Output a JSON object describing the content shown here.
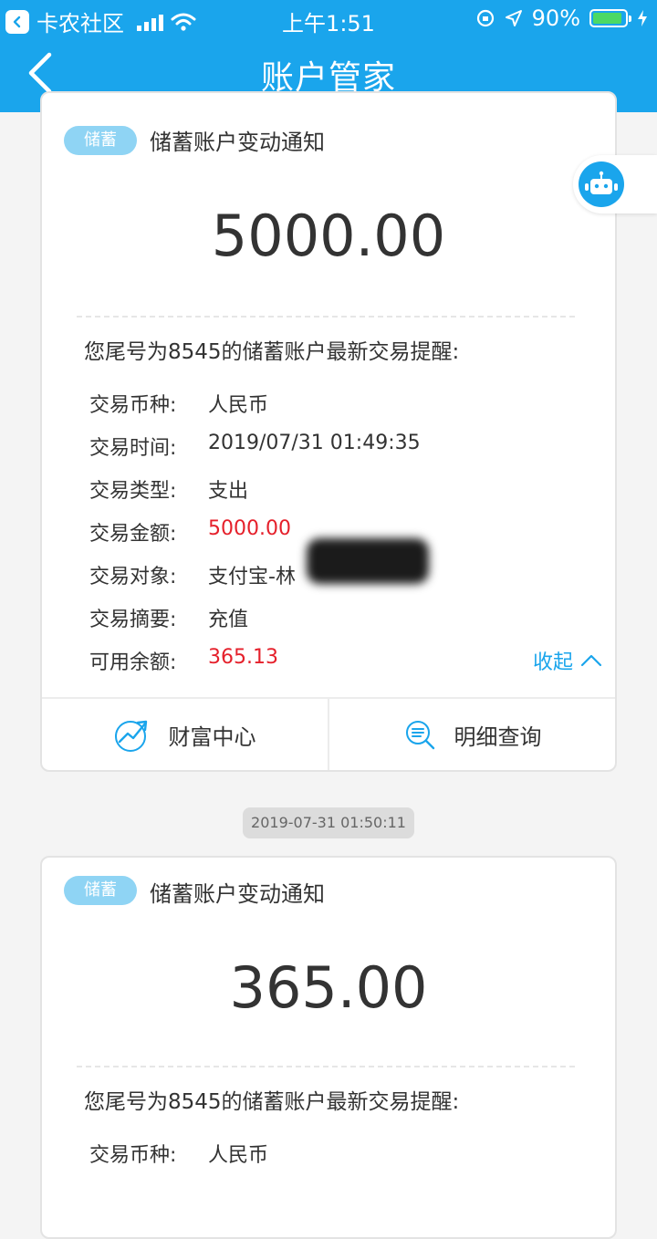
{
  "status_bar": {
    "carrier": "卡农社区",
    "time": "上午1:51",
    "battery": "90%",
    "battery_level": 0.9,
    "battery_color": "#4cd964"
  },
  "nav": {
    "title": "账户管家",
    "back_icon": "chevron-left-icon"
  },
  "colors": {
    "brand": "#1aa5ec",
    "amount_red": "#e5202b"
  },
  "assistant": {
    "icon": "robot-icon"
  },
  "card1": {
    "badge": "储蓄",
    "title": "储蓄账户变动通知",
    "amount": "5000.00",
    "notice": "您尾号为8545的储蓄账户最新交易提醒:",
    "rows": [
      {
        "label": "交易币种:",
        "value": "人民币"
      },
      {
        "label": "交易时间:",
        "value": "2019/07/31 01:49:35"
      },
      {
        "label": "交易类型:",
        "value": "支出"
      },
      {
        "label": "交易金额:",
        "value": "5000.00"
      },
      {
        "label": "交易对象:",
        "value": "支付宝-林"
      },
      {
        "label": "交易摘要:",
        "value": "充值"
      },
      {
        "label": "可用余额:",
        "value": "365.13"
      }
    ],
    "collapse_label": "收起",
    "actions": [
      {
        "label": "财富中心",
        "icon": "wealth-chart-icon"
      },
      {
        "label": "明细查询",
        "icon": "detail-search-icon"
      }
    ]
  },
  "timestamp": "2019-07-31 01:50:11",
  "card2": {
    "badge": "储蓄",
    "title": "储蓄账户变动通知",
    "amount": "365.00",
    "notice": "您尾号为8545的储蓄账户最新交易提醒:",
    "rows": [
      {
        "label": "交易币种:",
        "value": "人民币"
      }
    ]
  }
}
